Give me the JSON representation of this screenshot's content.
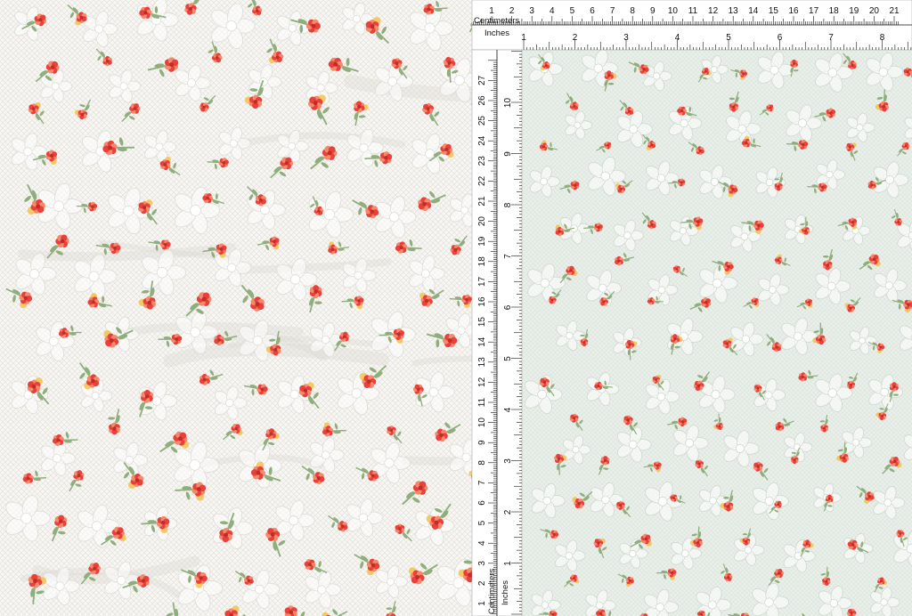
{
  "ruler": {
    "top_cm_title": "Centimeters",
    "top_in_title": "Inches",
    "left_cm_title": "Centimeters",
    "left_in_title": "Inches",
    "cm_labels": [
      "1",
      "2",
      "3",
      "4",
      "5",
      "6",
      "7",
      "8",
      "9",
      "10",
      "11",
      "12",
      "13",
      "14",
      "15",
      "16",
      "17",
      "18",
      "19",
      "20",
      "21"
    ],
    "in_labels": [
      "1",
      "2",
      "3",
      "4",
      "5",
      "6",
      "7",
      "8"
    ],
    "left_cm_labels": [
      "1",
      "2",
      "3",
      "4",
      "5",
      "6",
      "7",
      "8",
      "9",
      "10",
      "11",
      "12",
      "13",
      "14",
      "15",
      "16",
      "17",
      "18",
      "19",
      "20",
      "21",
      "22",
      "23",
      "24",
      "25",
      "26",
      "27"
    ],
    "left_in_labels": [
      "1",
      "2",
      "3",
      "4",
      "5",
      "6",
      "7",
      "8",
      "9",
      "10"
    ]
  },
  "colors": {
    "lace_base": "#f7f6f2",
    "flat_base": "#e9efe9",
    "floral_red": "#e8403a",
    "floral_coral": "#f28a6b",
    "floral_yellow": "#f2c24e",
    "leaf_green": "#8fae7d",
    "ruler_bg": "#ffffff",
    "ruler_ink": "#111111"
  }
}
